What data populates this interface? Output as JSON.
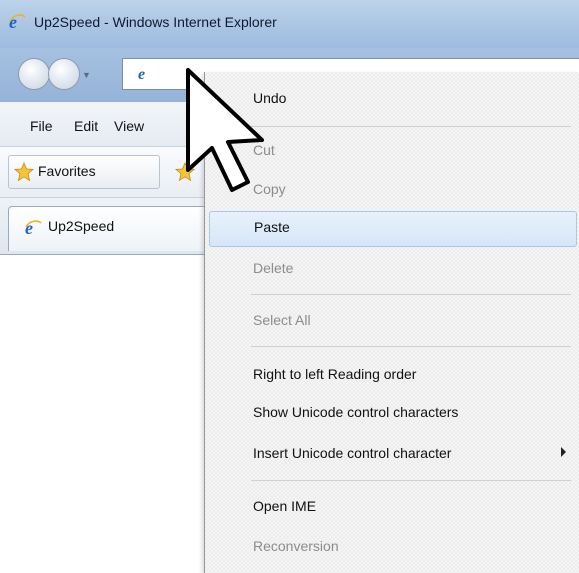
{
  "window": {
    "title": "Up2Speed - Windows Internet Explorer"
  },
  "menubar": {
    "items": [
      "File",
      "Edit",
      "View"
    ]
  },
  "favorites": {
    "label": "Favorites"
  },
  "tabs": [
    {
      "label": "Up2Speed"
    }
  ],
  "context_menu": {
    "items": [
      {
        "label": "Undo",
        "enabled": true
      },
      {
        "label": "Cut",
        "enabled": false
      },
      {
        "label": "Copy",
        "enabled": false
      },
      {
        "label": "Paste",
        "enabled": true,
        "highlighted": true
      },
      {
        "label": "Delete",
        "enabled": false
      },
      {
        "label": "Select All",
        "enabled": false
      },
      {
        "label": "Right to left Reading order",
        "enabled": true
      },
      {
        "label": "Show Unicode control characters",
        "enabled": true
      },
      {
        "label": "Insert Unicode control character",
        "enabled": true,
        "has_submenu": true
      },
      {
        "label": "Open IME",
        "enabled": true
      },
      {
        "label": "Reconversion",
        "enabled": false
      }
    ]
  },
  "icons": {
    "browser": "ie-icon",
    "favorites": "star-icon",
    "cursor": "pointer-cursor-icon",
    "submenu": "chevron-right-icon"
  },
  "colors": {
    "titlebar": "#a9c4e2",
    "menu_background": "#f5f5f5",
    "highlight": "#d6e6f8",
    "disabled_text": "#8c8c8c"
  }
}
